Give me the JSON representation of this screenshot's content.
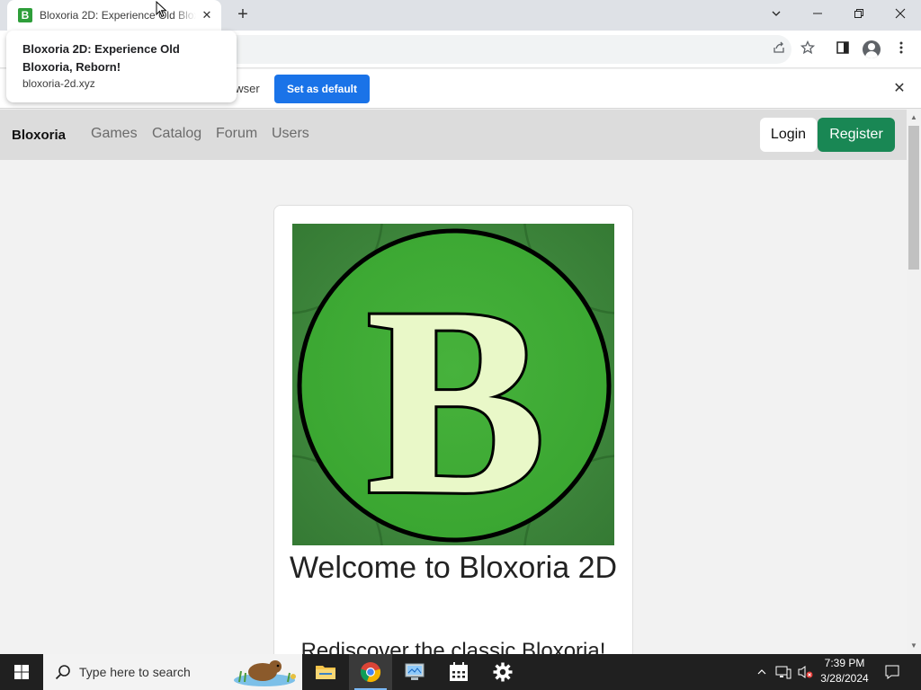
{
  "browser": {
    "tab_title": "Bloxoria 2D: Experience Old Bloxoria, Reborn!",
    "favicon_letter": "B",
    "new_tab": "+",
    "tab_close": "✕",
    "hovercard": {
      "title": "Bloxoria 2D: Experience Old Bloxoria, Reborn!",
      "url": "bloxoria-2d.xyz"
    },
    "infobar": {
      "text": "owser",
      "button": "Set as default",
      "close": "✕"
    },
    "window_controls": {
      "dropdown": "⌄",
      "minimize": "—",
      "restore": "❐",
      "close": "✕"
    }
  },
  "site": {
    "brand": "Bloxoria",
    "nav": [
      "Games",
      "Catalog",
      "Forum",
      "Users"
    ],
    "login": "Login",
    "register": "Register",
    "logo_letter": "B",
    "welcome": "Welcome to Bloxoria 2D",
    "subtitle": "Rediscover the classic Bloxoria!"
  },
  "taskbar": {
    "search_placeholder": "Type here to search",
    "time": "7:39 PM",
    "date": "3/28/2024"
  },
  "colors": {
    "brand_green": "#2e9e3a",
    "register_green": "#198754",
    "chrome_blue": "#1a73e8"
  }
}
